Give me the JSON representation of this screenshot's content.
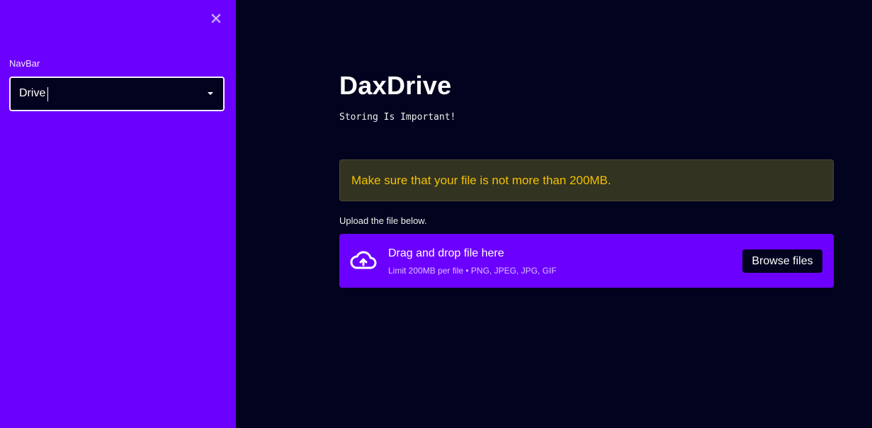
{
  "sidebar": {
    "close_icon": "close-icon",
    "nav_label": "NavBar",
    "nav_select_value": "Drive"
  },
  "main": {
    "title": "DaxDrive",
    "subtitle": "Storing Is Important!",
    "warning": "Make sure that your file is not more than 200MB.",
    "upload_label": "Upload the file below.",
    "dropzone": {
      "icon": "cloud-upload-icon",
      "title": "Drag and drop file here",
      "limit": "Limit 200MB per file • PNG, JPEG, JPG, GIF",
      "browse_label": "Browse files"
    }
  },
  "colors": {
    "sidebar_bg": "#6c00ff",
    "main_bg": "#02041f",
    "warning_bg": "#333321",
    "warning_text": "#f2c200",
    "dropzone_bg": "#6c00ff"
  }
}
